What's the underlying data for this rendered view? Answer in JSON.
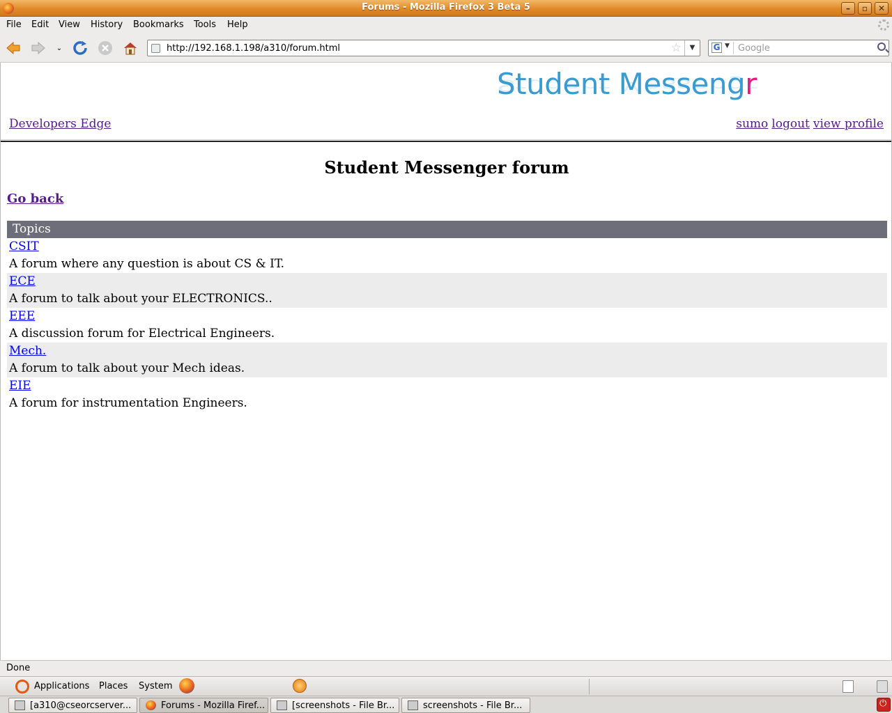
{
  "window": {
    "title": "Forums - Mozilla Firefox 3 Beta 5"
  },
  "menubar": {
    "items": [
      {
        "label": "File",
        "accel": "F"
      },
      {
        "label": "Edit",
        "accel": "E"
      },
      {
        "label": "View",
        "accel": "V"
      },
      {
        "label": "History",
        "accel": "s"
      },
      {
        "label": "Bookmarks",
        "accel": "B"
      },
      {
        "label": "Tools",
        "accel": "T"
      },
      {
        "label": "Help",
        "accel": "H"
      }
    ]
  },
  "navbar": {
    "url": "http://192.168.1.198/a310/forum.html",
    "search_placeholder": "Google",
    "search_engine_letter": "G"
  },
  "page": {
    "logo_text_main": "Student Messeng",
    "logo_text_accent": "r",
    "dev_edge_link": "Developers Edge",
    "username_link": "sumo",
    "logout_link": "logout",
    "profile_link": "view profile",
    "title": "Student Messenger forum",
    "go_back": "Go back",
    "topics_header": "Topics",
    "topics": [
      {
        "name": "CSIT",
        "description": "A forum where any question is about CS & IT."
      },
      {
        "name": "ECE",
        "description": "A forum to talk about your ELECTRONICS.."
      },
      {
        "name": "EEE",
        "description": "A discussion forum for Electrical Engineers."
      },
      {
        "name": "Mech.",
        "description": "A forum to talk about your Mech ideas."
      },
      {
        "name": "EIE",
        "description": "A forum for instrumentation Engineers."
      }
    ]
  },
  "statusbar": {
    "text": "Done"
  },
  "panel": {
    "applications": "Applications",
    "places": "Places",
    "system": "System"
  },
  "taskbar": {
    "tasks": [
      {
        "label": "[a310@cseorcserver..."
      },
      {
        "label": "Forums - Mozilla Firef..."
      },
      {
        "label": "[screenshots - File Br..."
      },
      {
        "label": "screenshots - File Br..."
      }
    ]
  },
  "colors": {
    "titlebar": "#e08a2a",
    "topics_header_bg": "#6e6e7a",
    "alt_row_bg": "#ececec",
    "logo_blue": "#3a9bd0",
    "logo_pink": "#e8177a",
    "visited_link": "#551a8b",
    "link": "#0000ee"
  }
}
